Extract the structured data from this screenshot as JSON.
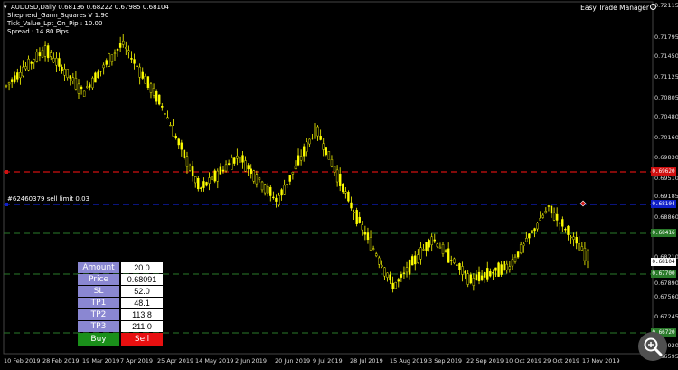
{
  "header": {
    "symbol_line": "AUDUSD,Daily  0.68136 0.68222 0.67985 0.68104",
    "indicator_name": "Shepherd_Gann_Squares V 1.90",
    "tick_value": "Tick_Value_Lpt_On_Pip : 10.00",
    "spread": "Spread : 14.80  Pips",
    "expert_name": "Easy Trade Manager",
    "expert_icon": "smiley-icon"
  },
  "order_line_label": "#62460379 sell limit 0.03",
  "price_tags": {
    "red_line": "0.69620",
    "current": "0.68104",
    "green_upper": "0.68416",
    "green_lower": "0.67700",
    "green_bottom": "0.66720"
  },
  "y_axis_labels": [
    "0.72115",
    "0.71795",
    "0.71450",
    "0.71125",
    "0.70805",
    "0.70480",
    "0.70160",
    "0.69830",
    "0.69510",
    "0.69185",
    "0.68860",
    "0.68210",
    "0.67890",
    "0.67560",
    "0.67245",
    "0.66920",
    "0.66595"
  ],
  "x_axis_labels": [
    "10 Feb 2019",
    "28 Feb 2019",
    "19 Mar 2019",
    "7 Apr 2019",
    "25 Apr 2019",
    "14 May 2019",
    "2 Jun 2019",
    "20 Jun 2019",
    "9 Jul 2019",
    "28 Jul 2019",
    "15 Aug 2019",
    "3 Sep 2019",
    "22 Sep 2019",
    "10 Oct 2019",
    "29 Oct 2019",
    "17 Nov 2019"
  ],
  "trade_panel": {
    "rows": [
      {
        "label": "Amount",
        "value": "20.0"
      },
      {
        "label": "Price",
        "value": "0.68091"
      },
      {
        "label": "SL",
        "value": "52.0"
      },
      {
        "label": "TP1",
        "value": "48.1"
      },
      {
        "label": "TP2",
        "value": "113.8"
      },
      {
        "label": "TP3",
        "value": "211.0"
      }
    ],
    "buy_label": "Buy",
    "sell_label": "Sell"
  },
  "colors": {
    "background": "#000000",
    "candles": "#ffff00",
    "stop_line": "#d01010",
    "order_line": "#1020c8",
    "target_lines": "#2a7a2a",
    "panel_label": "#8a87d2",
    "buy": "#1a8f1a",
    "sell": "#e81010"
  },
  "chart_data": {
    "type": "candlestick",
    "symbol": "AUDUSD",
    "timeframe": "Daily",
    "last_bar": {
      "open": 0.68136,
      "high": 0.68222,
      "low": 0.67985,
      "close": 0.68104
    },
    "ylim": [
      0.6652,
      0.7225
    ],
    "series": [
      {
        "x": "10 Feb 2019",
        "y": 0.709
      },
      {
        "x": "28 Feb 2019",
        "y": 0.715
      },
      {
        "x": "19 Mar 2019",
        "y": 0.708
      },
      {
        "x": "7 Apr 2019",
        "y": 0.716
      },
      {
        "x": "25 Apr 2019",
        "y": 0.706
      },
      {
        "x": "14 May 2019",
        "y": 0.692
      },
      {
        "x": "2 Jun 2019",
        "y": 0.6975
      },
      {
        "x": "20 Jun 2019",
        "y": 0.69
      },
      {
        "x": "9 Jul 2019",
        "y": 0.702
      },
      {
        "x": "28 Jul 2019",
        "y": 0.688
      },
      {
        "x": "15 Aug 2019",
        "y": 0.676
      },
      {
        "x": "3 Sep 2019",
        "y": 0.684
      },
      {
        "x": "22 Sep 2019",
        "y": 0.677
      },
      {
        "x": "10 Oct 2019",
        "y": 0.6795
      },
      {
        "x": "29 Oct 2019",
        "y": 0.689
      },
      {
        "x": "17 Nov 2019",
        "y": 0.681
      }
    ],
    "levels": {
      "stop": 0.6962,
      "order": 0.691,
      "target_upper": 0.6842,
      "target_lower": 0.677,
      "target_bottom": 0.6672
    }
  }
}
